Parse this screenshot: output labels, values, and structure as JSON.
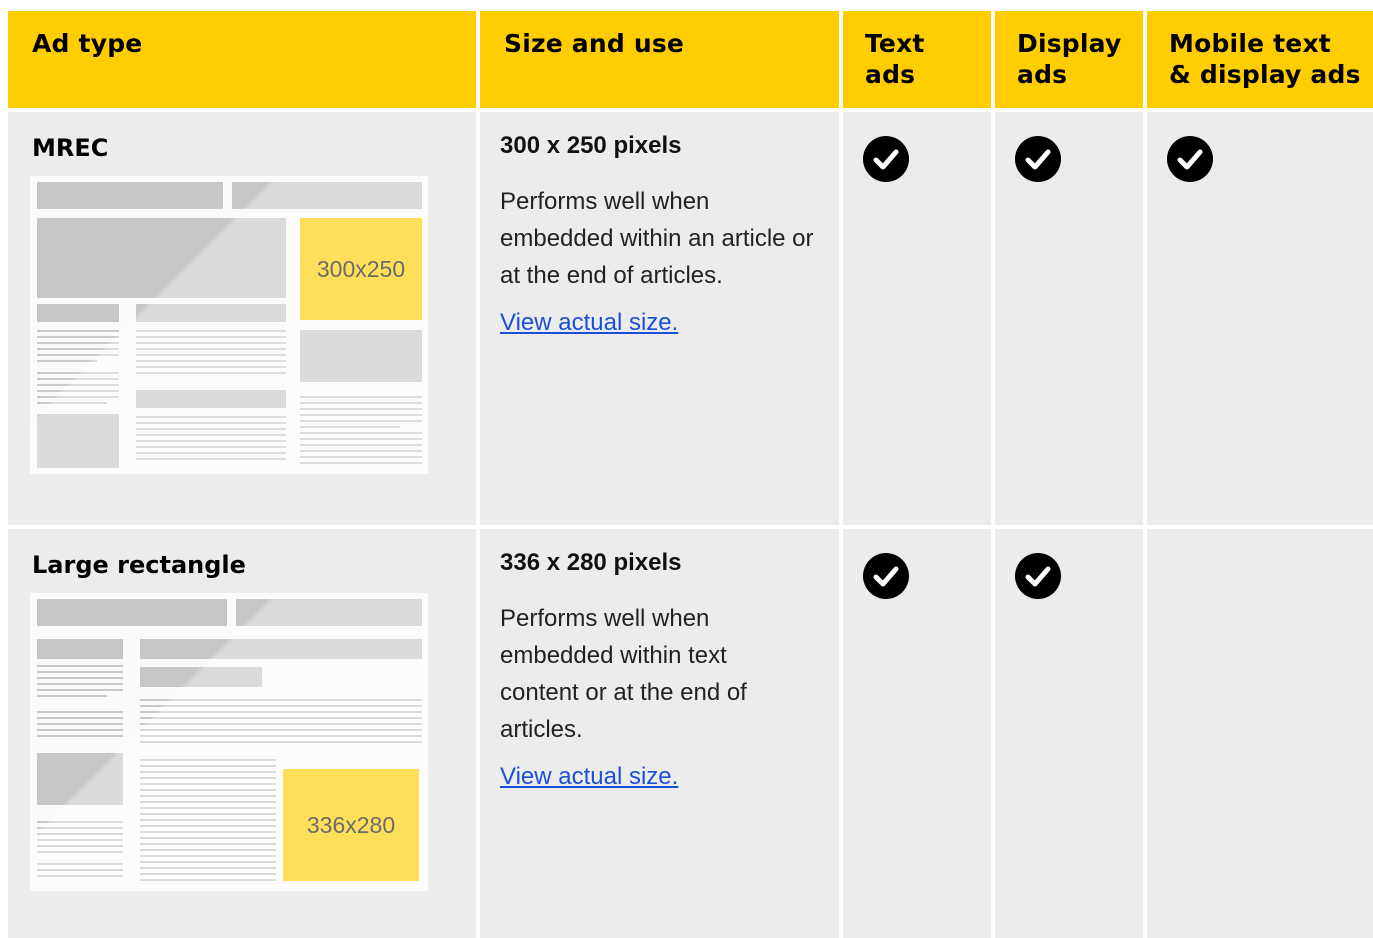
{
  "header": {
    "ad_type": "Ad type",
    "size_and_use": "Size and use",
    "text_ads_1": "Text",
    "text_ads_2": "ads",
    "display_ads_1": "Display",
    "display_ads_2": "ads",
    "mobile_1": "Mobile text",
    "mobile_2": "& display ads"
  },
  "rows": [
    {
      "name": "MREC",
      "size": "300 x 250 pixels",
      "description": "Performs well when embedded within an article or at the end of articles.",
      "link": "View actual size.",
      "ad_label": "300x250",
      "text_ads": true,
      "display_ads": true,
      "mobile_ads": true
    },
    {
      "name": "Large rectangle",
      "size": "336 x 280 pixels",
      "description": "Performs well when embedded within text content or at the end of articles.",
      "link": "View actual size.",
      "ad_label": "336x280",
      "text_ads": true,
      "display_ads": true,
      "mobile_ads": false
    }
  ],
  "icons": {
    "check": "check-circle-icon"
  },
  "colors": {
    "header_bg": "#ffcd00",
    "cell_bg": "#ececec",
    "link": "#1a4fd8"
  }
}
